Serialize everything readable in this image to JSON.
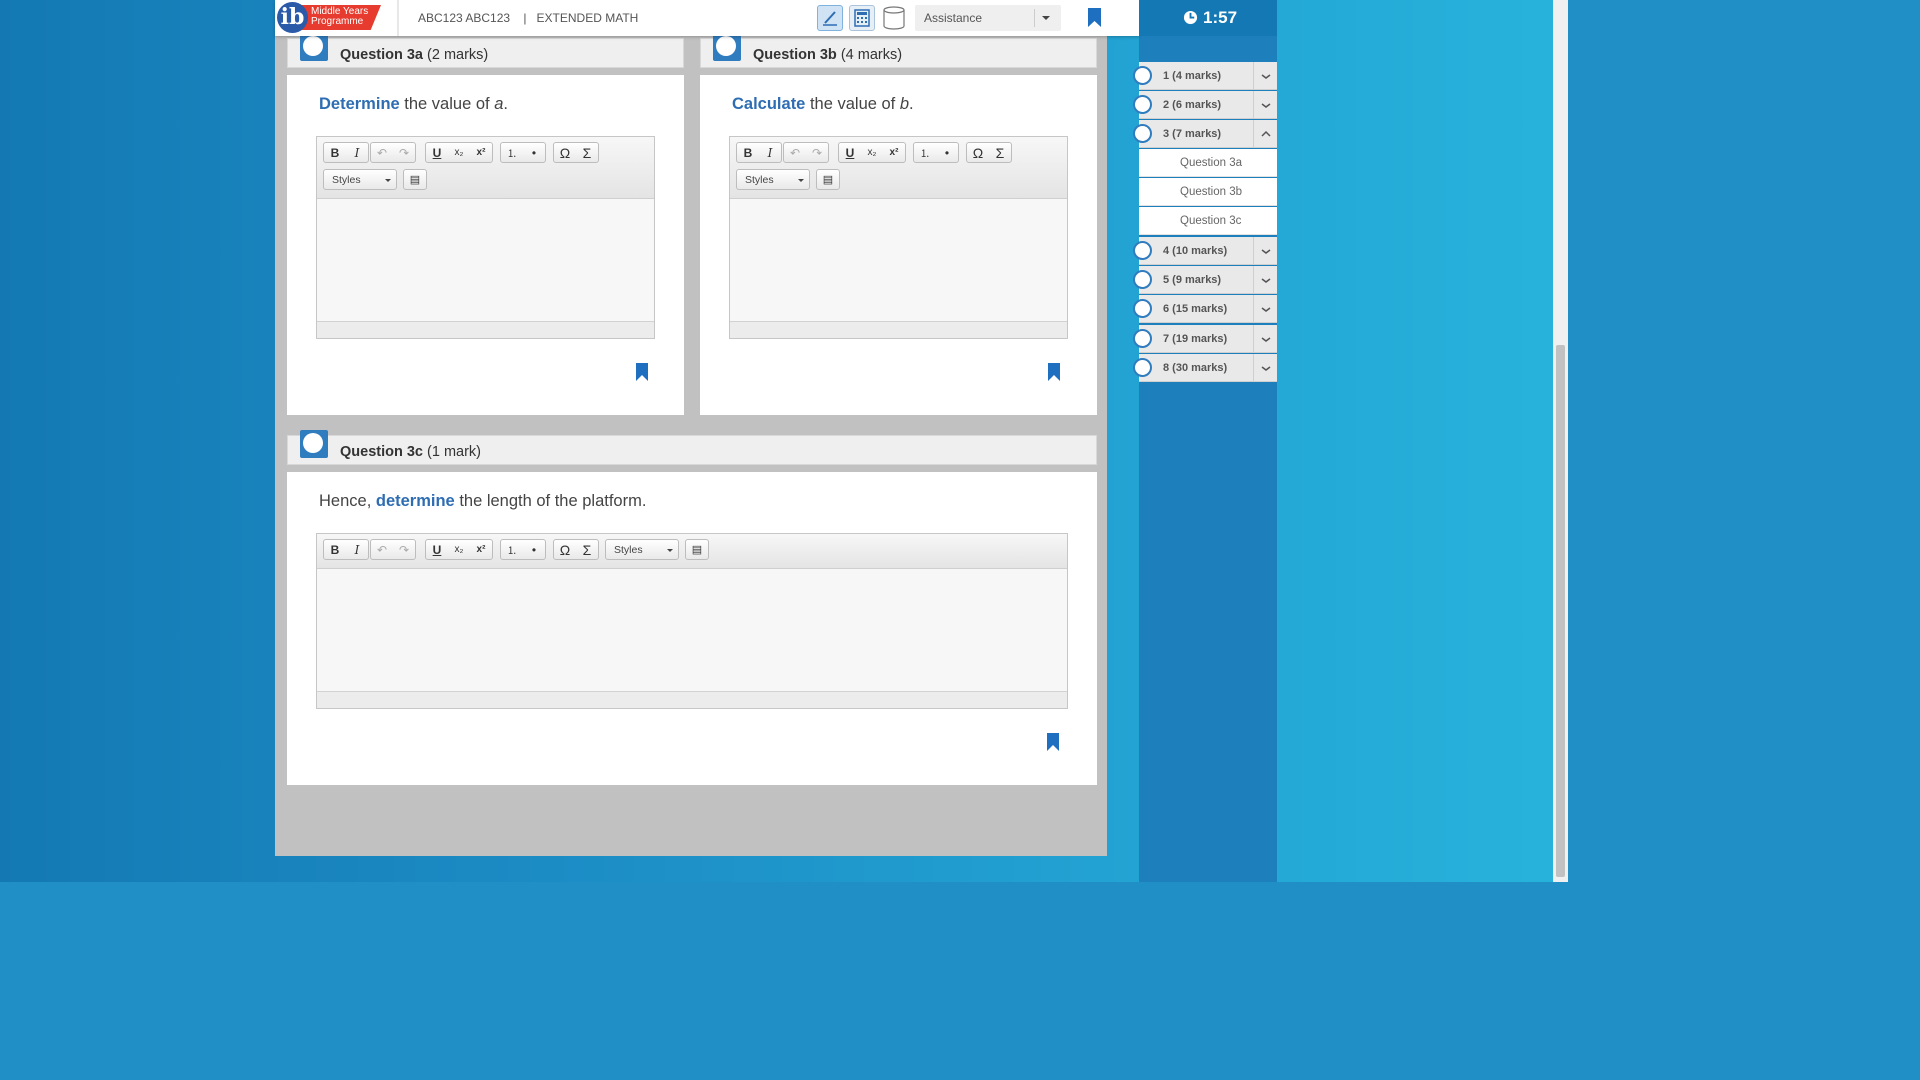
{
  "header": {
    "logo_text_line1": "Middle Years",
    "logo_text_line2": "Programme",
    "logo_letter": "ib",
    "candidate": "ABC123 ABC123",
    "divider": "|",
    "subject": "EXTENDED MATH",
    "assistance_label": "Assistance"
  },
  "timer": {
    "value": "1:57"
  },
  "nav": {
    "items": [
      {
        "label": "1 (4 marks)"
      },
      {
        "label": "2 (6 marks)"
      },
      {
        "label": "3 (7 marks)",
        "expanded": true,
        "sub": [
          {
            "label": "Question 3a"
          },
          {
            "label": "Question 3b"
          },
          {
            "label": "Question 3c"
          }
        ]
      },
      {
        "label": "4 (10 marks)"
      },
      {
        "label": "5 (9 marks)"
      },
      {
        "label": "6 (15 marks)"
      },
      {
        "label": "7 (19 marks)"
      },
      {
        "label": "8 (30 marks)"
      }
    ]
  },
  "questions": {
    "q3a": {
      "number": "Question 3a",
      "marks": "(2 marks)",
      "command": "Determine",
      "text": " the value of ",
      "var": "a",
      "end": "."
    },
    "q3b": {
      "number": "Question 3b",
      "marks": "(4 marks)",
      "command": "Calculate",
      "text": " the value of ",
      "var": "b",
      "end": "."
    },
    "q3c": {
      "number": "Question 3c",
      "marks": "(1 mark)",
      "pre": "Hence, ",
      "command": "determine",
      "text": " the length of the platform."
    }
  },
  "editor": {
    "bold": "B",
    "italic": "I",
    "undo": "↶",
    "redo": "↷",
    "underline": "U",
    "subscript": "x₂",
    "superscript": "x²",
    "ordered": "⒈",
    "bullets": "•",
    "omega": "Ω",
    "sigma": "Σ",
    "styles_label": "Styles"
  },
  "colors": {
    "accent": "#2f6db3",
    "brand_red": "#e63b2e",
    "timer_bg": "#1478b5"
  }
}
